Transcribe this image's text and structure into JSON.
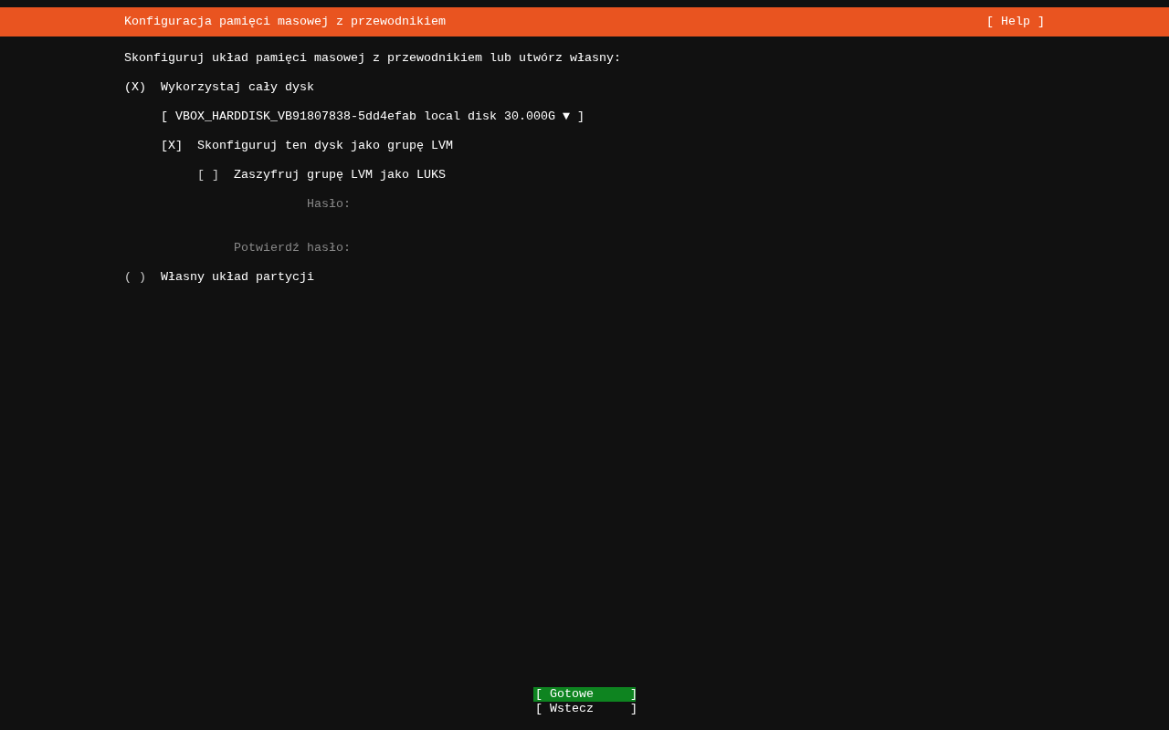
{
  "header": {
    "title": "Konfiguracja pamięci masowej z przewodnikiem",
    "help": "[ Help ]"
  },
  "intro": "Skonfiguruj układ pamięci masowej z przewodnikiem lub utwórz własny:",
  "options": [
    {
      "mark": "(X)",
      "label": "Wykorzystaj cały dysk",
      "selected": true,
      "disk": "[ VBOX_HARDDISK_VB91807838-5dd4efab local disk 30.000G ▼ ]",
      "lvm": {
        "mark": "[X]",
        "label": "Skonfiguruj ten dysk jako grupę LVM",
        "checked": true,
        "luks": {
          "mark": "[ ]",
          "label": "Zaszyfruj grupę LVM jako LUKS",
          "checked": false,
          "fields": [
            {
              "label": "Hasło:",
              "disabled": true
            },
            {
              "label": "Potwierdź hasło:",
              "disabled": true
            }
          ]
        }
      }
    },
    {
      "mark": "( )",
      "label": "Własny układ partycji",
      "selected": false
    }
  ],
  "buttons": [
    {
      "label": "[ Gotowe     ]",
      "selected": true
    },
    {
      "label": "[ Wstecz     ]",
      "selected": false
    }
  ]
}
